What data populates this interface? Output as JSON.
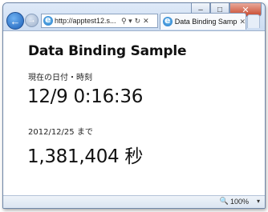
{
  "browser": {
    "address_url": "http://apptest12.s...",
    "tab_title": "Data Binding Sample",
    "zoom_label": "100%",
    "icons": {
      "back": "back-arrow-icon",
      "forward": "forward-arrow-icon",
      "search": "search-icon",
      "refresh": "refresh-icon",
      "stop": "stop-icon",
      "tab_close": "close-icon",
      "zoom": "zoom-icon"
    },
    "caption_buttons": {
      "minimize": "–",
      "maximize": "□",
      "close": "✕"
    },
    "toolbar_glyphs": {
      "search": "⚲ ▾",
      "refresh": "↻",
      "stop": "✕",
      "tab_close": "✕",
      "dropdown": "▾",
      "zoom": "🔍",
      "back": "←",
      "forward": "→"
    }
  },
  "page": {
    "title": "Data Binding Sample",
    "current_label": "現在の日付・時刻",
    "current_value": "12/9 0:16:36",
    "until_label": "2012/12/25 まで",
    "countdown_value": "1,381,404 秒"
  }
}
